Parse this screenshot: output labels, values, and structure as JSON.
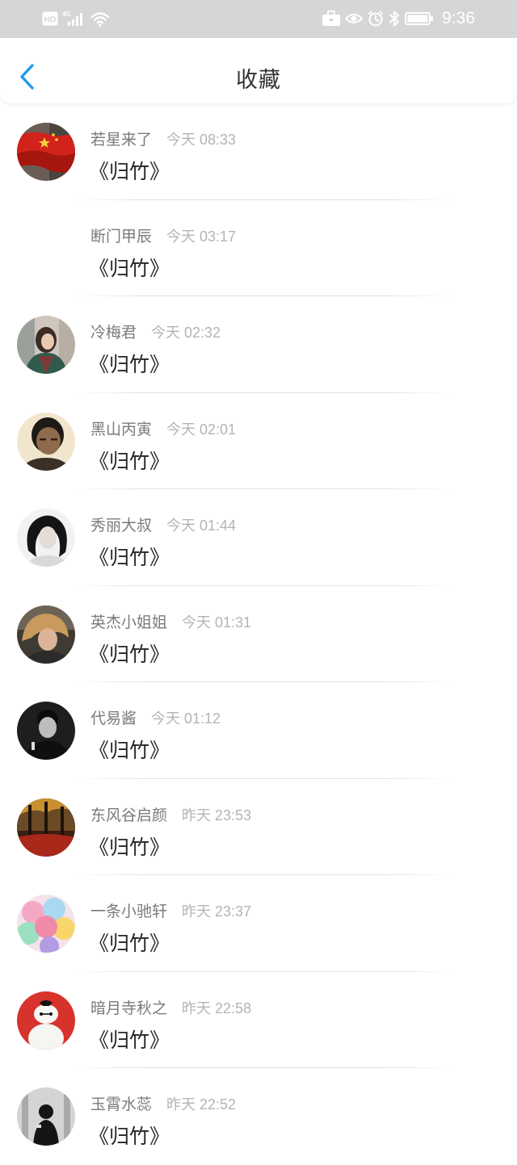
{
  "status_bar": {
    "time": "9:36",
    "hd_badge": "HD",
    "network": "4G",
    "icons": [
      "hd-icon",
      "signal-4g-icon",
      "wifi-icon",
      "briefcase-icon",
      "eye-icon",
      "alarm-icon",
      "bluetooth-icon",
      "battery-icon"
    ]
  },
  "header": {
    "title": "收藏",
    "back_icon": "chevron-left-icon"
  },
  "colors": {
    "accent": "#1e9be9",
    "status_bar_bg": "#d6d6d6",
    "username": "#7a7a7a",
    "timestamp": "#b4b4b4",
    "work_title": "#262626"
  },
  "items": [
    {
      "username": "若星来了",
      "time": "今天 08:33",
      "title": "《归竹》",
      "avatar": "flag-avatar"
    },
    {
      "username": "断门甲辰",
      "time": "今天 03:17",
      "title": "《归竹》",
      "avatar": "none"
    },
    {
      "username": "冷梅君",
      "time": "今天 02:32",
      "title": "《归竹》",
      "avatar": "girl-avatar"
    },
    {
      "username": "黑山丙寅",
      "time": "今天 02:01",
      "title": "《归竹》",
      "avatar": "man-avatar"
    },
    {
      "username": "秀丽大叔",
      "time": "今天 01:44",
      "title": "《归竹》",
      "avatar": "girl-bw-avatar"
    },
    {
      "username": "英杰小姐姐",
      "time": "今天 01:31",
      "title": "《归竹》",
      "avatar": "blonde-avatar"
    },
    {
      "username": "代易酱",
      "time": "今天 01:12",
      "title": "《归竹》",
      "avatar": "man-bw-avatar"
    },
    {
      "username": "东风谷启颜",
      "time": "昨天 23:53",
      "title": "《归竹》",
      "avatar": "autumn-avatar"
    },
    {
      "username": "一条小驰轩",
      "time": "昨天 23:37",
      "title": "《归竹》",
      "avatar": "balloons-avatar"
    },
    {
      "username": "暗月寺秋之",
      "time": "昨天 22:58",
      "title": "《归竹》",
      "avatar": "baymax-avatar"
    },
    {
      "username": "玉霄水蕊",
      "time": "昨天 22:52",
      "title": "《归竹》",
      "avatar": "figure-avatar"
    }
  ]
}
